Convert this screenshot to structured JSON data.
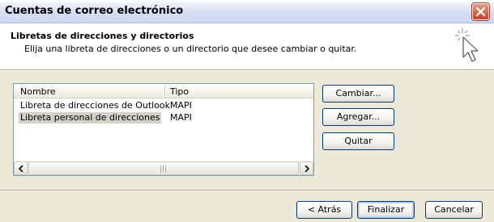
{
  "window": {
    "title": "Cuentas de correo electrónico",
    "close_icon": "close-icon"
  },
  "header": {
    "title": "Libretas de direcciones y directorios",
    "subtitle": "Elija una libreta de direcciones o un directorio que desee cambiar o quitar.",
    "icon": "wizard-cursor-icon"
  },
  "list": {
    "columns": [
      "Nombre",
      "Tipo"
    ],
    "rows": [
      {
        "name": "Libreta de direcciones de Outlook",
        "type": "MAPI",
        "selected": false
      },
      {
        "name": "Libreta personal de direcciones",
        "type": "MAPI",
        "selected": true
      }
    ],
    "scrollbar_icons": [
      "arrow-left-icon",
      "arrow-right-icon"
    ]
  },
  "side_buttons": {
    "change": "Cambiar...",
    "add": "Agregar...",
    "remove": "Quitar"
  },
  "footer": {
    "back": "< Atrás",
    "finish": "Finalizar",
    "cancel": "Cancelar"
  }
}
